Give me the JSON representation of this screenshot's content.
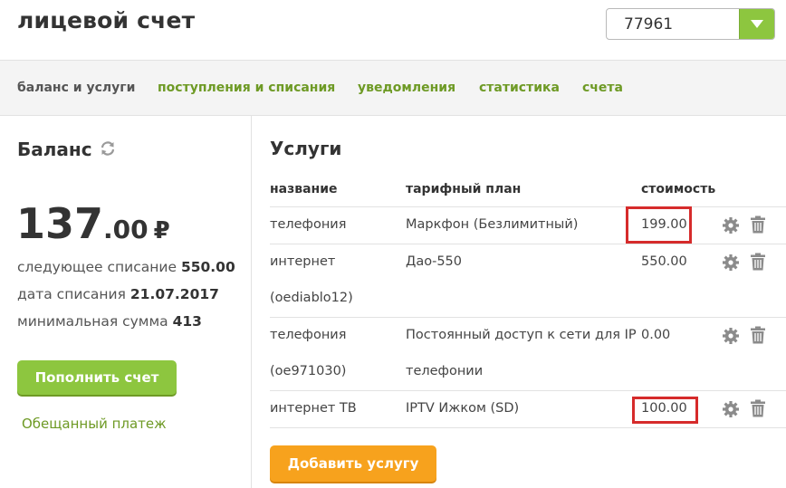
{
  "header": {
    "title": "лицевой счет",
    "account_selected": "77961"
  },
  "tabs": [
    {
      "label": "баланс и услуги",
      "active": true
    },
    {
      "label": "поступления и списания",
      "active": false
    },
    {
      "label": "уведомления",
      "active": false
    },
    {
      "label": "статистика",
      "active": false
    },
    {
      "label": "счета",
      "active": false
    }
  ],
  "balance": {
    "title": "Баланс",
    "amount_int": "137",
    "amount_frac": ".00",
    "currency": "₽",
    "next_charge_label": "следующее списание",
    "next_charge_value": "550.00",
    "charge_date_label": "дата списания",
    "charge_date_value": "21.07.2017",
    "min_sum_label": "минимальная сумма",
    "min_sum_value": "413",
    "topup_label": "Пополнить счет",
    "promised_label": "Обещанный платеж"
  },
  "services": {
    "title": "Услуги",
    "columns": [
      "название",
      "тарифный план",
      "стоимость"
    ],
    "rows": [
      {
        "name": "телефония",
        "name2": "",
        "plan": "Маркфон (Безлимитный)",
        "plan2": "",
        "price": "199.00",
        "highlight": true
      },
      {
        "name": "интернет",
        "name2": "(oediablo12)",
        "plan": "Дао-550",
        "plan2": "",
        "price": "550.00",
        "highlight": false
      },
      {
        "name": "телефония",
        "name2": "(oe971030)",
        "plan": "Постоянный доступ к сети для IP",
        "plan2": "телефонии",
        "price": "0.00",
        "highlight": false
      },
      {
        "name": "интернет ТВ",
        "name2": "",
        "plan": "IPTV Ижком (SD)",
        "plan2": "",
        "price": "100.00",
        "highlight": true
      }
    ],
    "add_label": "Добавить услугу"
  },
  "colors": {
    "accent_green": "#8dc63f",
    "link_green": "#6e9a25",
    "accent_orange": "#f7a21d",
    "highlight_red": "#d62b2b"
  },
  "icons": [
    "refresh-icon",
    "gear-icon",
    "trash-icon",
    "chevron-down-icon"
  ]
}
